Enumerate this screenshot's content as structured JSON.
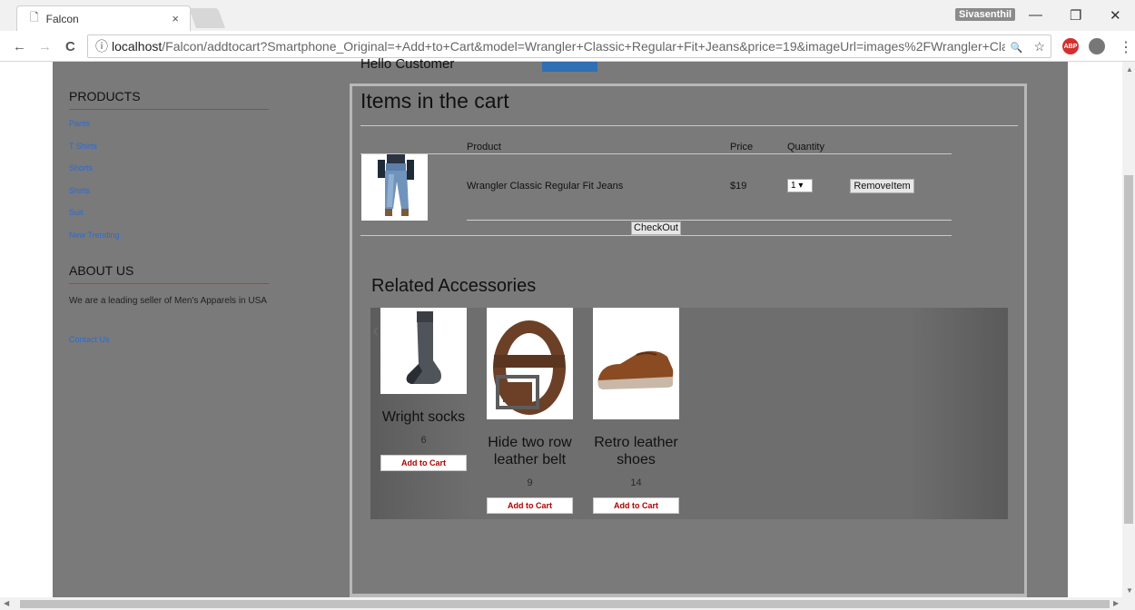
{
  "browser": {
    "tab_title": "Falcon",
    "tab_close": "×",
    "user_name": "Sivasenthil",
    "url_host": "localhost",
    "url_path": "/Falcon/addtocart?Smartphone_Original=+Add+to+Cart&model=Wrangler+Classic+Regular+Fit+Jeans&price=19&imageUrl=images%2FWrangler+Cla...",
    "info_icon": "ⓘ",
    "back_icon": "←",
    "forward_icon": "→",
    "reload_icon": "C",
    "zoom_icon": "🔍",
    "star_icon": "☆",
    "abp_label": "ABP",
    "menu_icon": "⋮",
    "minimize": "—",
    "restore": "❐",
    "close": "✕"
  },
  "sidebar": {
    "products_heading": "PRODUCTS",
    "products": [
      "Pants",
      "T Shirts",
      "Shorts",
      "Shirts",
      "Suit",
      "New Trending"
    ],
    "about_heading": "ABOUT US",
    "about_text": "We are a leading seller of Men's Apparels in USA",
    "contact_link": "Contact Us"
  },
  "cart": {
    "greeting": "Hello Customer",
    "title": "Items in the cart",
    "columns": {
      "product": "Product",
      "price": "Price",
      "quantity": "Quantity"
    },
    "item": {
      "name": "Wrangler Classic Regular Fit Jeans",
      "price": "$19",
      "quantity": "1 ▾",
      "remove_label": "RemoveItem"
    },
    "checkout_label": "CheckOut"
  },
  "related": {
    "title": "Related Accessories",
    "items": [
      {
        "name": "Wright socks",
        "price": "6",
        "button": "Add to Cart"
      },
      {
        "name": "Hide two row leather belt",
        "price": "9",
        "button": "Add to Cart"
      },
      {
        "name": "Retro leather shoes",
        "price": "14",
        "button": "Add to Cart"
      }
    ],
    "prev_icon": "‹",
    "next_icon": "›"
  }
}
